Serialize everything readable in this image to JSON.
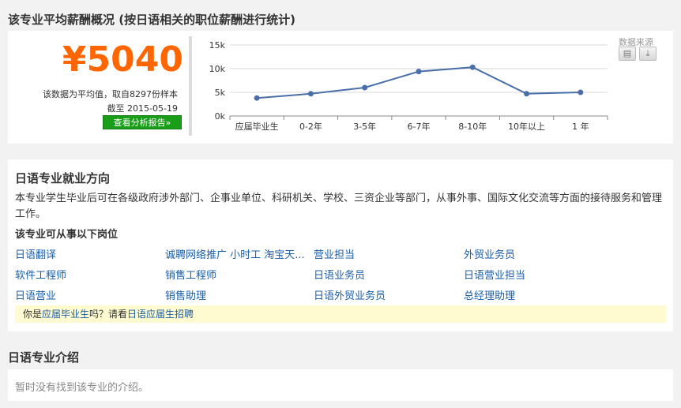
{
  "salary_section": {
    "title": "该专业平均薪酬概况 (按日语相关的职位薪酬进行统计)",
    "value": "¥5040",
    "note_line1": "该数据为平均值，取自8297份样本",
    "note_line2": "截至 2015-05-19",
    "report_button": "查看分析报告»",
    "source_label": "数据来源",
    "print_icon": "printer-icon",
    "download_icon": "download-icon"
  },
  "chart_data": {
    "type": "line",
    "categories": [
      "应届毕业生",
      "0-2年",
      "3-5年",
      "6-7年",
      "8-10年",
      "10年以上",
      "1 年"
    ],
    "values": [
      3800,
      4700,
      6000,
      9400,
      10300,
      4700,
      5000
    ],
    "y_ticks": [
      "0k",
      "5k",
      "10k",
      "15k"
    ],
    "ylim": [
      0,
      15000
    ],
    "grid": true,
    "line_color": "#4a6ea8"
  },
  "direction_section": {
    "title": "日语专业就业方向",
    "description": "本专业学生毕业后可在各级政府涉外部门、企事业单位、科研机关、学校、三资企业等部门，从事外事、国际文化交流等方面的接待服务和管理工作。",
    "posts_title": "该专业可从事以下岗位",
    "jobs": [
      [
        "日语翻译",
        "诚聘网络推广 小时工 淘宝天...",
        "营业担当",
        "外贸业务员"
      ],
      [
        "软件工程师",
        "销售工程师",
        "日语业务员",
        "日语营业担当"
      ],
      [
        "日语营业",
        "销售助理",
        "日语外贸业务员",
        "总经理助理"
      ]
    ],
    "tip_prefix": "你是",
    "tip_link1": "应届毕业生",
    "tip_middle": "吗？请看",
    "tip_link2": "日语应届生招聘"
  },
  "intro_section": {
    "title": "日语专业介绍",
    "text": "暂时没有找到该专业的介绍。"
  }
}
